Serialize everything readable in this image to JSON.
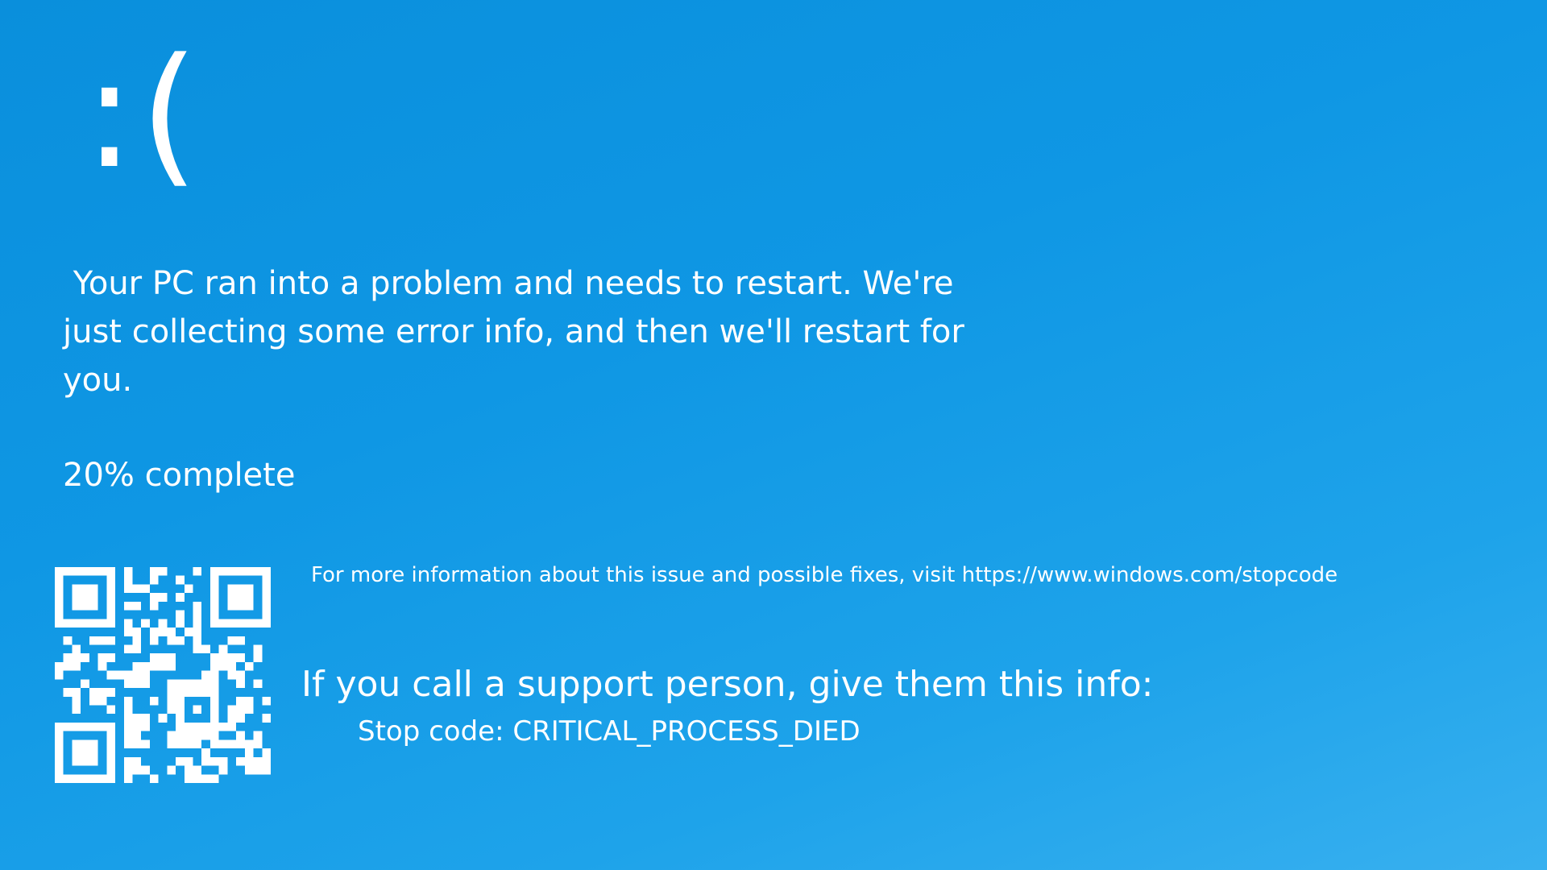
{
  "screen": {
    "background_color": "#0f97e4",
    "text_color": "#ffffff"
  },
  "sad_face": ":(",
  "message": " Your PC ran into a problem and needs to restart. We're just collecting some error info, and then we'll restart for you.",
  "progress": {
    "percent": 20,
    "label": "20% complete"
  },
  "qr_code": {
    "icon": "qr-code-icon"
  },
  "more_info": "For more information about this issue and possible fixes, visit https://www.windows.com/stopcode",
  "support_prompt": "If you call a support person, give them this info:",
  "stop_code": "Stop code: CRITICAL_PROCESS_DIED"
}
